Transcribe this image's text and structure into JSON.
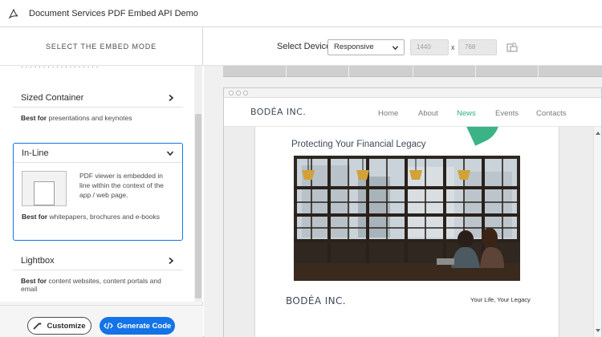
{
  "app": {
    "title": "Document Services PDF Embed API Demo"
  },
  "left_panel": {
    "heading": "SELECT THE EMBED MODE",
    "modes": [
      {
        "title": "Sized Container",
        "best_prefix": "Best for",
        "best_text": " presentations and keynotes",
        "expanded": false
      },
      {
        "title": "In-Line",
        "description": "PDF viewer is embedded in line within the context of the app / web page.",
        "best_prefix": "Best for",
        "best_text": " whitepapers, brochures and e-books",
        "expanded": true,
        "selected": true
      },
      {
        "title": "Lightbox",
        "best_prefix": "Best for",
        "best_text": " content websites, content portals and email",
        "expanded": false
      }
    ],
    "customize_label": "Customize",
    "generate_label": "Generate Code"
  },
  "toolbar": {
    "device_label": "Select Device",
    "device_value": "Responsive",
    "width_value": "1440",
    "x_label": "x",
    "height_value": "768"
  },
  "website": {
    "logo": "BODÉA INC.",
    "nav": [
      "Home",
      "About",
      "News",
      "Events",
      "Contacts"
    ],
    "active_nav": "News"
  },
  "pdf": {
    "heading": "Protecting Your Financial Legacy",
    "logo": "BODÉA INC.",
    "tagline": "Your Life, Your Legacy"
  },
  "colors": {
    "accent_blue": "#1473e6",
    "nav_active_green": "#2fae85",
    "leaf_green": "#3bb386"
  }
}
